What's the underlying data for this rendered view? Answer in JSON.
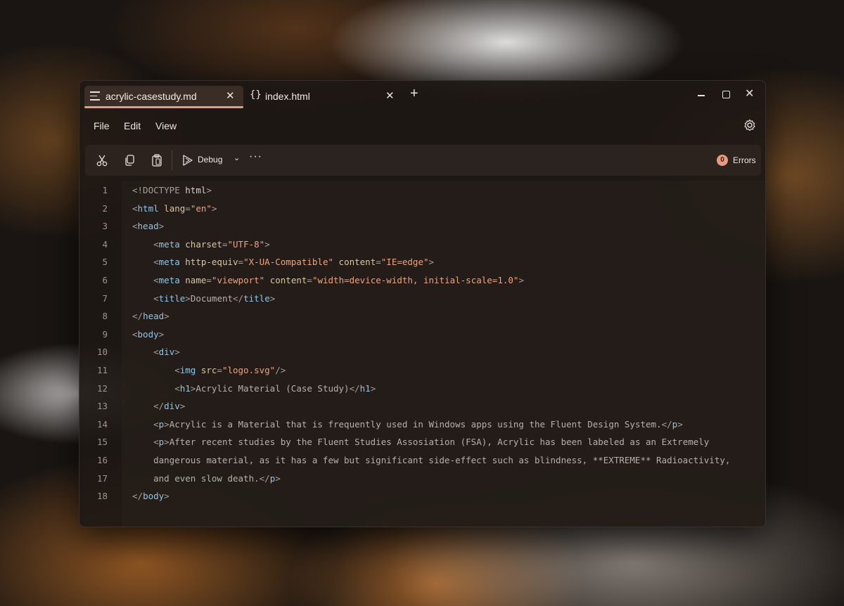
{
  "tabs": [
    {
      "label": "acrylic-casestudy.md",
      "icon": "document-lines-icon",
      "active": true
    },
    {
      "label": "index.html",
      "icon": "braces-icon",
      "active": false
    }
  ],
  "tab_braces_glyph": "{}",
  "tab_close_glyph": "✕",
  "new_tab_glyph": "+",
  "window_close_glyph": "✕",
  "menu": {
    "file": "File",
    "edit": "Edit",
    "view": "View"
  },
  "toolbar": {
    "debug_label": "Debug",
    "debug_chevron": "⌄",
    "more_label": "···",
    "errors_count": "0",
    "errors_label": "Errors"
  },
  "colors": {
    "accent": "#e89a7e",
    "tag": "#8dc6e8",
    "string": "#e8a483",
    "attribute": "#d9c6a8"
  },
  "code": {
    "line_numbers": [
      "1",
      "2",
      "3",
      "4",
      "5",
      "6",
      "7",
      "8",
      "9",
      "10",
      "11",
      "12",
      "13",
      "14",
      "15",
      "16",
      "17",
      "18"
    ],
    "lines": [
      [
        [
          "b",
          "<!DOCTYPE "
        ],
        [
          "kw",
          "html"
        ],
        [
          "b",
          ">"
        ]
      ],
      [
        [
          "b",
          "<"
        ],
        [
          "tag",
          "html"
        ],
        [
          "attr",
          " lang"
        ],
        [
          "b",
          "="
        ],
        [
          "str",
          "\"en\""
        ],
        [
          "b",
          ">"
        ]
      ],
      [
        [
          "b",
          "<"
        ],
        [
          "tag",
          "head"
        ],
        [
          "b",
          ">"
        ]
      ],
      [
        [
          "b",
          "    <"
        ],
        [
          "tag",
          "meta"
        ],
        [
          "attr",
          " charset"
        ],
        [
          "b",
          "="
        ],
        [
          "str",
          "\"UTF-8\""
        ],
        [
          "b",
          ">"
        ]
      ],
      [
        [
          "b",
          "    <"
        ],
        [
          "tag",
          "meta"
        ],
        [
          "attr",
          " http-equiv"
        ],
        [
          "b",
          "="
        ],
        [
          "str",
          "\"X-UA-Compatible\""
        ],
        [
          "attr",
          " content"
        ],
        [
          "b",
          "="
        ],
        [
          "str",
          "\"IE=edge\""
        ],
        [
          "b",
          ">"
        ]
      ],
      [
        [
          "b",
          "    <"
        ],
        [
          "tag",
          "meta"
        ],
        [
          "attr",
          " name"
        ],
        [
          "b",
          "="
        ],
        [
          "str",
          "\"viewport\""
        ],
        [
          "attr",
          " content"
        ],
        [
          "b",
          "="
        ],
        [
          "str",
          "\"width=device-width, initial-scale=1.0\""
        ],
        [
          "b",
          ">"
        ]
      ],
      [
        [
          "b",
          "    <"
        ],
        [
          "tag",
          "title"
        ],
        [
          "b",
          ">"
        ],
        [
          "text",
          "Document"
        ],
        [
          "b",
          "</"
        ],
        [
          "tag",
          "title"
        ],
        [
          "b",
          ">"
        ]
      ],
      [
        [
          "b",
          "</"
        ],
        [
          "tag",
          "head"
        ],
        [
          "b",
          ">"
        ]
      ],
      [
        [
          "b",
          "<"
        ],
        [
          "tag",
          "body"
        ],
        [
          "b",
          ">"
        ]
      ],
      [
        [
          "b",
          "    <"
        ],
        [
          "tag",
          "div"
        ],
        [
          "b",
          ">"
        ]
      ],
      [
        [
          "b",
          "        <"
        ],
        [
          "tag",
          "img"
        ],
        [
          "attr",
          " src"
        ],
        [
          "b",
          "="
        ],
        [
          "str",
          "\"logo.svg\""
        ],
        [
          "b",
          "/>"
        ]
      ],
      [
        [
          "b",
          "        <"
        ],
        [
          "tag",
          "h1"
        ],
        [
          "b",
          ">"
        ],
        [
          "text",
          "Acrylic Material (Case Study)"
        ],
        [
          "b",
          "</"
        ],
        [
          "tag",
          "h1"
        ],
        [
          "b",
          ">"
        ]
      ],
      [
        [
          "b",
          "    </"
        ],
        [
          "tag",
          "div"
        ],
        [
          "b",
          ">"
        ]
      ],
      [
        [
          "b",
          "    <"
        ],
        [
          "tag",
          "p"
        ],
        [
          "b",
          ">"
        ],
        [
          "text",
          "Acrylic is a Material that is frequently used in Windows apps using the Fluent Design System."
        ],
        [
          "b",
          "</"
        ],
        [
          "tag",
          "p"
        ],
        [
          "b",
          ">"
        ]
      ],
      [
        [
          "b",
          "    <"
        ],
        [
          "tag",
          "p"
        ],
        [
          "b",
          ">"
        ],
        [
          "text",
          "After recent studies by the Fluent Studies Assosiation (FSA), Acrylic has been labeled as an Extremely"
        ]
      ],
      [
        [
          "text",
          "    dangerous material, as it has a few but significant side-effect such as blindness, **EXTREME** Radioactivity,"
        ]
      ],
      [
        [
          "text",
          "    and even slow death."
        ],
        [
          "b",
          "</"
        ],
        [
          "tag",
          "p"
        ],
        [
          "b",
          ">"
        ]
      ],
      [
        [
          "b",
          "</"
        ],
        [
          "tag",
          "body"
        ],
        [
          "b",
          ">"
        ]
      ]
    ]
  }
}
